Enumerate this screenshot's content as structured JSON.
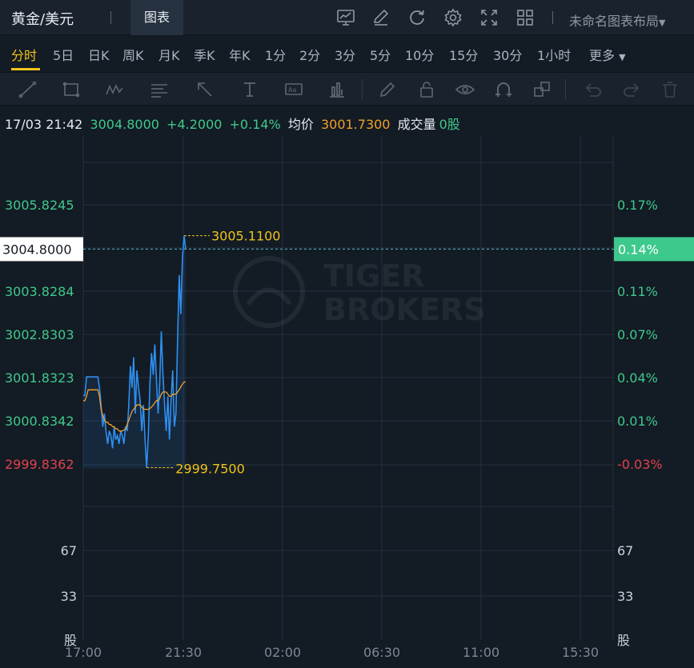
{
  "header": {
    "symbol": "黄金/美元",
    "chart_tab": "图表",
    "layout_label": "未命名图表布局",
    "icons": [
      "chart-settings-icon",
      "edit-icon",
      "refresh-icon",
      "gear-icon",
      "fullscreen-icon",
      "grid-layout-icon",
      "chevron-down-icon"
    ]
  },
  "timeframes": {
    "items": [
      "分时",
      "5日",
      "日K",
      "周K",
      "月K",
      "季K",
      "年K",
      "1分",
      "2分",
      "3分",
      "5分",
      "10分",
      "15分",
      "30分",
      "1小时"
    ],
    "active": "分时",
    "more_label": "更多"
  },
  "tools": [
    "trend-line-icon",
    "rectangle-icon",
    "pattern-icon",
    "fibonacci-icon",
    "arrow-icon",
    "text-tool-icon",
    "annotation-icon",
    "price-range-icon",
    "pen-icon",
    "lock-icon",
    "eye-icon",
    "magnet-icon",
    "clone-icon",
    "undo-icon",
    "redo-icon",
    "trash-icon"
  ],
  "info": {
    "datetime": "17/03 21:42",
    "price": "3004.8000",
    "change": "+4.2000",
    "change_pct": "+0.14%",
    "avg_label": "均价",
    "avg_value": "3001.7300",
    "volume_label": "成交量",
    "volume_value": "0股"
  },
  "colors": {
    "price_line": "#2f8ff0",
    "avg_line": "#f0a028",
    "up": "#3ec98c",
    "down": "#e0424d",
    "marker": "#f0c419",
    "background": "#131b24"
  },
  "chart_data": {
    "type": "line",
    "watermark": "TIGER BROKERS",
    "y_left_ticks": [
      "3005.8245",
      "3004.8000",
      "3003.8284",
      "3002.8303",
      "3001.8323",
      "3000.8342",
      "2999.8362"
    ],
    "y_left_values": [
      3005.8245,
      3004.8,
      3003.8284,
      3002.8303,
      3001.8323,
      3000.8342,
      2999.8362
    ],
    "y_right_ticks": [
      "0.17%",
      "0.14%",
      "0.11%",
      "0.07%",
      "0.04%",
      "0.01%",
      "-0.03%"
    ],
    "x_ticks": [
      "17:00",
      "21:30",
      "02:00",
      "06:30",
      "11:00",
      "15:30"
    ],
    "volume_ticks": [
      "67",
      "33"
    ],
    "volume_unit": "股",
    "current_price": "3004.8000",
    "current_pct": "0.14%",
    "high_label": "3005.1100",
    "low_label": "2999.7500",
    "high_value": 3005.11,
    "low_value": 2999.75,
    "series": [
      {
        "values": [
          3001.42,
          3001.42,
          3001.85,
          3001.85,
          3001.85,
          3001.85,
          3001.85,
          3001.85,
          3001.85,
          3001.85,
          3001.6,
          3001.2,
          3000.7,
          3001.0,
          3000.6,
          3000.3,
          3000.6,
          3000.5,
          3000.2,
          3000.7,
          3000.4,
          3000.5,
          3000.3,
          3000.6,
          3000.5,
          3000.3,
          3000.7,
          3000.6,
          3001.2,
          3002.1,
          3001.6,
          3002.3,
          3001.0,
          3002.0,
          3001.6,
          3001.3,
          3000.6,
          3001.2,
          3000.4,
          2999.75,
          3000.5,
          3001.7,
          3002.4,
          3001.9,
          3002.6,
          3001.8,
          3001.0,
          3001.7,
          3002.9,
          3001.9,
          3001.2,
          3000.6,
          3001.4,
          3000.4,
          3001.3,
          3002.0,
          3000.7,
          3001.0,
          3002.7,
          3004.2,
          3003.3,
          3004.6,
          3005.11,
          3004.8
        ]
      },
      {
        "values": [
          3001.3,
          3001.3,
          3001.4,
          3001.55,
          3001.55,
          3001.55,
          3001.55,
          3001.55,
          3001.55,
          3001.55,
          3001.4,
          3001.1,
          3000.95,
          3000.85,
          3000.8,
          3000.8,
          3000.75,
          3000.75,
          3000.7,
          3000.7,
          3000.65,
          3000.65,
          3000.6,
          3000.6,
          3000.6,
          3000.62,
          3000.65,
          3000.75,
          3000.85,
          3000.95,
          3001.05,
          3001.1,
          3001.15,
          3001.2,
          3001.2,
          3001.2,
          3001.15,
          3001.1,
          3001.1,
          3001.1,
          3001.1,
          3001.12,
          3001.15,
          3001.2,
          3001.25,
          3001.3,
          3001.3,
          3001.35,
          3001.45,
          3001.5,
          3001.5,
          3001.5,
          3001.45,
          3001.4,
          3001.4,
          3001.45,
          3001.45,
          3001.45,
          3001.5,
          3001.55,
          3001.62,
          3001.68,
          3001.73,
          3001.73
        ]
      }
    ]
  }
}
